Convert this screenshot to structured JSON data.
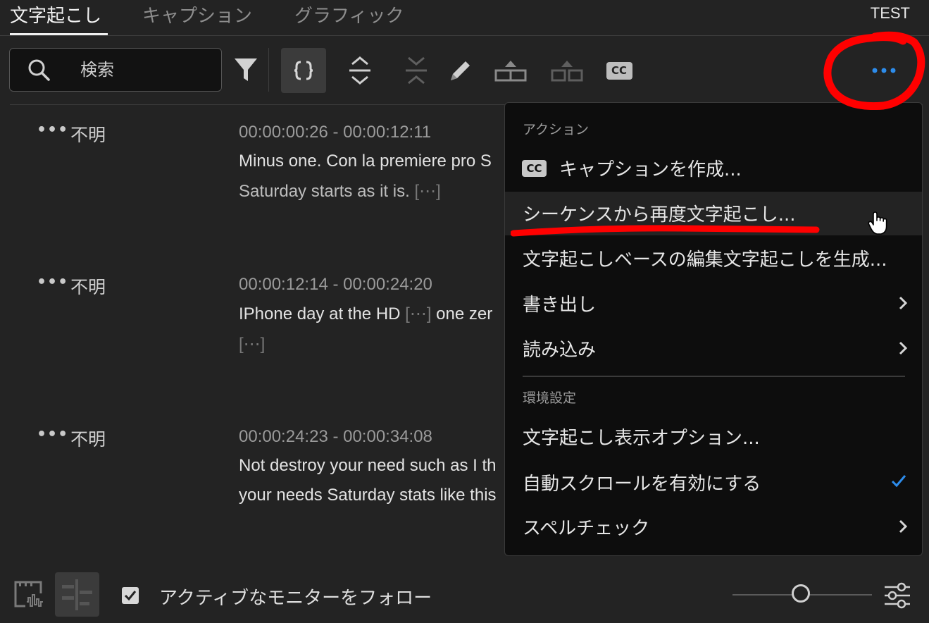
{
  "tabs": [
    {
      "label": "文字起こし",
      "active": true
    },
    {
      "label": "キャプション",
      "active": false
    },
    {
      "label": "グラフィック",
      "active": false
    }
  ],
  "project_name": "TEST",
  "search": {
    "placeholder": "検索",
    "value": ""
  },
  "toolbar": {
    "icons": [
      "filter-icon",
      "transcript-mode-toggle-icon",
      "expand-icon",
      "collapse-icon",
      "pencil-icon",
      "merge-segments-icon",
      "split-segment-icon",
      "cc-icon",
      "more-options-icon"
    ]
  },
  "segments": [
    {
      "speaker": "不明",
      "timecode": "00:00:00:26 - 00:00:12:11",
      "lines": [
        "Minus one. Con la premiere pro S",
        "Saturday starts as it is."
      ],
      "gap": "[⋯]"
    },
    {
      "speaker": "不明",
      "timecode": "00:00:12:14 - 00:00:24:20",
      "lines": [
        "IPhone day at the HD",
        "one zer"
      ],
      "gap": "[⋯]"
    },
    {
      "speaker": "不明",
      "timecode": "00:00:24:23 - 00:00:34:08",
      "lines": [
        "Not destroy your need such as I th",
        "your needs Saturday stats like this"
      ]
    }
  ],
  "menu": {
    "section_actions": "アクション",
    "items": [
      {
        "label": "キャプションを作成...",
        "icon": "cc-icon"
      },
      {
        "label": "シーケンスから再度文字起こし...",
        "hovered": true
      },
      {
        "label": "文字起こしベースの編集文字起こしを生成..."
      },
      {
        "label": "書き出し",
        "submenu": true
      },
      {
        "label": "読み込み",
        "submenu": true
      }
    ],
    "section_preferences": "環境設定",
    "pref_items": [
      {
        "label": "文字起こし表示オプション..."
      },
      {
        "label": "自動スクロールを有効にする",
        "checked": true
      },
      {
        "label": "スペルチェック",
        "submenu": true
      }
    ]
  },
  "footer": {
    "follow_label": "アクティブなモニターをフォロー",
    "follow_checked": true
  },
  "colors": {
    "accent": "#2d8ceb",
    "annotation": "#ff0000",
    "background": "#232323",
    "menu_background": "#0d0d0d"
  }
}
